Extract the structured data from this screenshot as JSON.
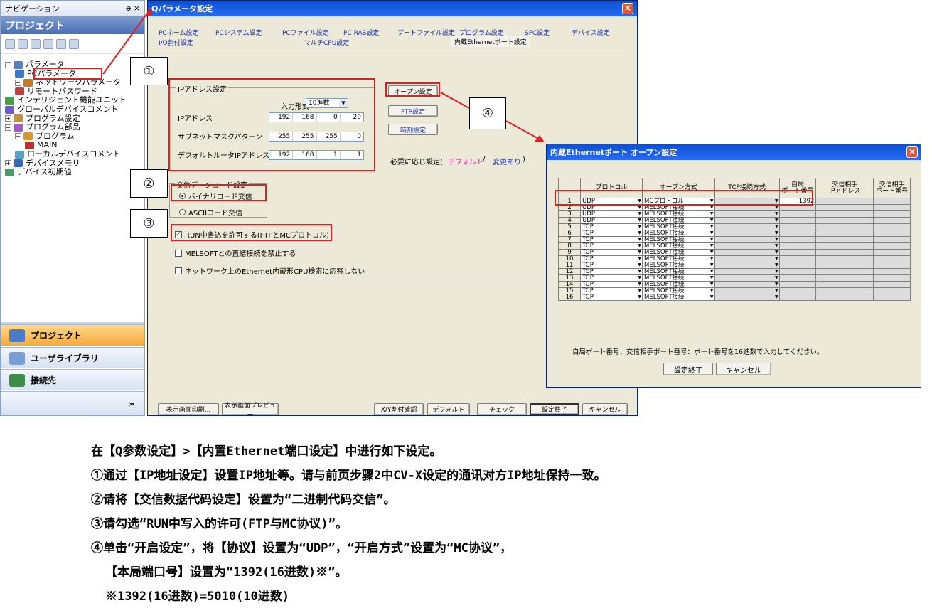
{
  "nav": {
    "header": "ナビゲーション",
    "pin": "ᵽ ×",
    "project_title": "プロジェクト",
    "tree": [
      {
        "label": "パラメータ",
        "level": 0,
        "expander": "−"
      },
      {
        "label": "PCパラメータ",
        "level": 1,
        "expander": ""
      },
      {
        "label": "ネットワークパラメータ",
        "level": 1,
        "expander": "+"
      },
      {
        "label": "リモートパスワード",
        "level": 1,
        "expander": ""
      },
      {
        "label": "インテリジェント機能ユニット",
        "level": 0,
        "expander": ""
      },
      {
        "label": "グローバルデバイスコメント",
        "level": 0,
        "expander": ""
      },
      {
        "label": "プログラム設定",
        "level": 0,
        "expander": "+"
      },
      {
        "label": "プログラム部品",
        "level": 0,
        "expander": "−"
      },
      {
        "label": "プログラム",
        "level": 1,
        "expander": "−"
      },
      {
        "label": "MAIN",
        "level": 2,
        "expander": ""
      },
      {
        "label": "ローカルデバイスコメント",
        "level": 1,
        "expander": ""
      },
      {
        "label": "デバイスメモリ",
        "level": 0,
        "expander": "+"
      },
      {
        "label": "デバイス初期値",
        "level": 0,
        "expander": ""
      }
    ],
    "bottom": [
      "プロジェクト",
      "ユーザライブラリ",
      "接続先"
    ],
    "more": "»"
  },
  "qwin": {
    "title": "Qパラメータ設定",
    "tabs_row1": [
      "PCネーム設定",
      "PCシステム設定",
      "PCファイル設定",
      "PC RAS設定",
      "ブートファイル設定",
      "プログラム設定",
      "SFC設定",
      "デバイス設定"
    ],
    "tabs_row2": [
      "I/O割付設定",
      "マルチCPU設定",
      "内蔵Ethernetポート設定"
    ],
    "ip_group_title": "IPアドレス設定",
    "input_format_label": "入力形式",
    "input_format_value": "10進数",
    "ip_label": "IPアドレス",
    "ip_values": [
      "192",
      "168",
      "0",
      "20"
    ],
    "subnet_label": "サブネットマスクパターン",
    "subnet_values": [
      "255",
      "255",
      "255",
      "0"
    ],
    "gateway_label": "デフォルトルータIPアドレス",
    "gateway_values": [
      "192",
      "168",
      "1",
      "1"
    ],
    "btn_open": "オープン設定",
    "btn_ftp": "FTP設定",
    "btn_time": "時刻設定",
    "need_setting": "必要に応じ設定(",
    "default_link": "デフォルト",
    "slash": "/",
    "changed_link": "変更あり",
    "close_paren": ")",
    "code_group_title": "交信データコード設定",
    "radio_binary": "バイナリコード交信",
    "radio_ascii": "ASCIIコード交信",
    "check_run": "RUN中書込を許可する(FTPとMCプロトコル)",
    "check_melsoft": "MELSOFTとの直結接続を禁止する",
    "check_network": "ネットワーク上のEthernet内蔵形CPU検索に応答しない",
    "footer_buttons": [
      "表示画面印刷...",
      "表示画面プレビュー",
      "X/Y割付確認",
      "デフォルト",
      "チェック",
      "設定終了",
      "キャンセル"
    ]
  },
  "edlg": {
    "title": "内蔵Ethernetポート オープン設定",
    "headers": [
      "プロトコル",
      "オープン方式",
      "TCP接続方式",
      "自局\nポート番号",
      "交信相手\nIPアドレス",
      "交信相手\nポート番号"
    ],
    "rows": [
      {
        "n": "1",
        "protocol": "UDP",
        "open": "MCプロトコル",
        "port": "1392"
      },
      {
        "n": "2",
        "protocol": "UDP",
        "open": "MELSOFT接続",
        "port": ""
      },
      {
        "n": "3",
        "protocol": "UDP",
        "open": "MELSOFT接続",
        "port": ""
      },
      {
        "n": "4",
        "protocol": "UDP",
        "open": "MELSOFT接続",
        "port": ""
      },
      {
        "n": "5",
        "protocol": "TCP",
        "open": "MELSOFT接続",
        "port": ""
      },
      {
        "n": "6",
        "protocol": "TCP",
        "open": "MELSOFT接続",
        "port": ""
      },
      {
        "n": "7",
        "protocol": "TCP",
        "open": "MELSOFT接続",
        "port": ""
      },
      {
        "n": "8",
        "protocol": "TCP",
        "open": "MELSOFT接続",
        "port": ""
      },
      {
        "n": "9",
        "protocol": "TCP",
        "open": "MELSOFT接続",
        "port": ""
      },
      {
        "n": "10",
        "protocol": "TCP",
        "open": "MELSOFT接続",
        "port": ""
      },
      {
        "n": "11",
        "protocol": "TCP",
        "open": "MELSOFT接続",
        "port": ""
      },
      {
        "n": "12",
        "protocol": "TCP",
        "open": "MELSOFT接続",
        "port": ""
      },
      {
        "n": "13",
        "protocol": "TCP",
        "open": "MELSOFT接続",
        "port": ""
      },
      {
        "n": "14",
        "protocol": "TCP",
        "open": "MELSOFT接続",
        "port": ""
      },
      {
        "n": "15",
        "protocol": "TCP",
        "open": "MELSOFT接続",
        "port": ""
      },
      {
        "n": "16",
        "protocol": "TCP",
        "open": "MELSOFT接続",
        "port": ""
      }
    ],
    "note": "自局ポート番号、交信相手ポート番号：ポート番号を16進数で入力してください。",
    "btn_ok": "設定終了",
    "btn_cancel": "キャンセル"
  },
  "callouts": [
    "①",
    "②",
    "③",
    "④"
  ],
  "description": [
    "在【Q参数设定】>【内置Ethernet端口设定】中进行如下设定。",
    "①通过【IP地址设定】设置IP地址等。请与前页步骤2中CV-X设定的通讯对方IP地址保持一致。",
    "②请将【交信数据代码设定】设置为“二进制代码交信”。",
    "③请勾选“RUN中写入的许可(FTP与MC协议)”。",
    "④单击“开启设定”，将【协议】设置为“UDP”，“开启方式”设置为“MC协议”，",
    "【本局端口号】设置为“1392(16进数)※”。",
    "※1392(16进数)=5010(10进数)"
  ],
  "colors": {
    "accent_red": "#e02020",
    "title_blue": "#0a4fd6",
    "link_blue": "#1a2fa8"
  }
}
